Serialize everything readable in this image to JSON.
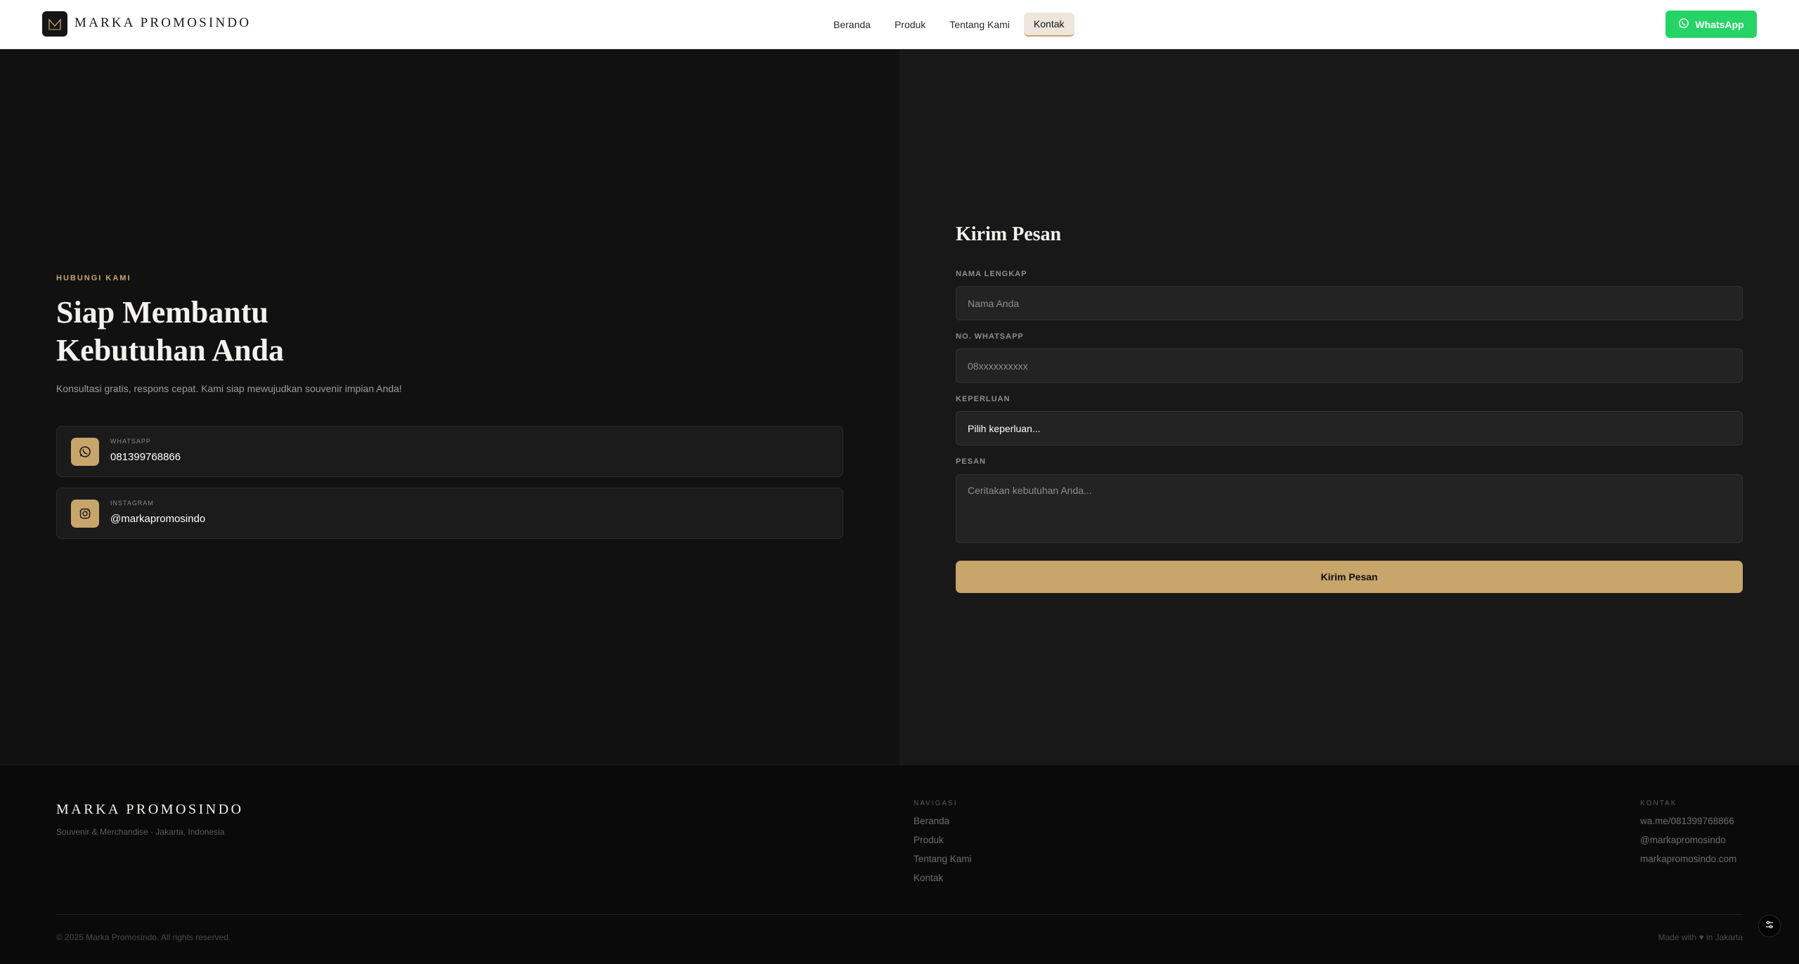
{
  "header": {
    "logo_text": "MARKA PROMOSINDO",
    "nav": [
      {
        "label": "Beranda"
      },
      {
        "label": "Produk"
      },
      {
        "label": "Tentang Kami"
      },
      {
        "label": "Kontak",
        "active": true
      }
    ],
    "whatsapp_label": "WhatsApp"
  },
  "hero": {
    "eyebrow": "HUBUNGI KAMI",
    "title_line1": "Siap Membantu",
    "title_line2": "Kebutuhan Anda",
    "subtitle": "Konsultasi gratis, respons cepat. Kami siap mewujudkan souvenir impian Anda!"
  },
  "contacts": [
    {
      "label": "WHATSAPP",
      "value": "081399768866",
      "icon": "whatsapp-icon"
    },
    {
      "label": "INSTAGRAM",
      "value": "@markapromosindo",
      "icon": "instagram-icon"
    }
  ],
  "form": {
    "title": "Kirim Pesan",
    "name_label": "NAMA LENGKAP",
    "name_placeholder": "Nama Anda",
    "phone_label": "NO. WHATSAPP",
    "phone_placeholder": "08xxxxxxxxxx",
    "purpose_label": "KEPERLUAN",
    "purpose_selected": "Pilih keperluan...",
    "message_label": "PESAN",
    "message_placeholder": "Ceritakan kebutuhan Anda...",
    "submit_label": "Kirim Pesan"
  },
  "footer": {
    "brand": "MARKA PROMOSINDO",
    "tagline": "Souvenir & Merchandise · Jakarta, Indonesia",
    "nav_title": "NAVIGASI",
    "nav_links": [
      "Beranda",
      "Produk",
      "Tentang Kami",
      "Kontak"
    ],
    "contact_title": "KONTAK",
    "contact_links": [
      "wa.me/081399768866",
      "@markapromosindo",
      "markapromosindo.com"
    ],
    "copyright": "© 2025 Marka Promosindo. All rights reserved.",
    "made_with": "Made with ♥ in Jakarta"
  },
  "colors": {
    "accent": "#c8a56a",
    "whatsapp": "#25d366",
    "background": "#111111",
    "panel": "#181818"
  }
}
